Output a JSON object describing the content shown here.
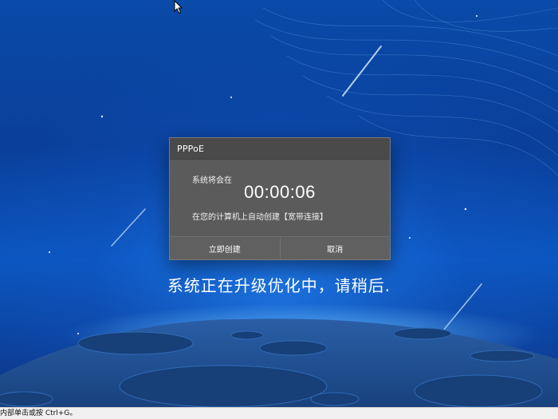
{
  "dialog": {
    "title": "PPPoE",
    "line1": "系统将会在",
    "timer": "00:00:06",
    "line2": "在您的计算机上自动创建【宽带连接】",
    "buttons": {
      "create_now": "立即创建",
      "cancel": "取消"
    }
  },
  "status_text": "系统正在升级优化中，请稍后.",
  "bottom_hint": "内部单击或按 Ctrl+G。",
  "colors": {
    "background": "#0b4aa8",
    "dialog_bg": "#5b5b5b",
    "dialog_title_bg": "#4a4a4a",
    "moon": "#1e4f8e"
  },
  "icons": [
    "mouse-cursor-icon"
  ]
}
